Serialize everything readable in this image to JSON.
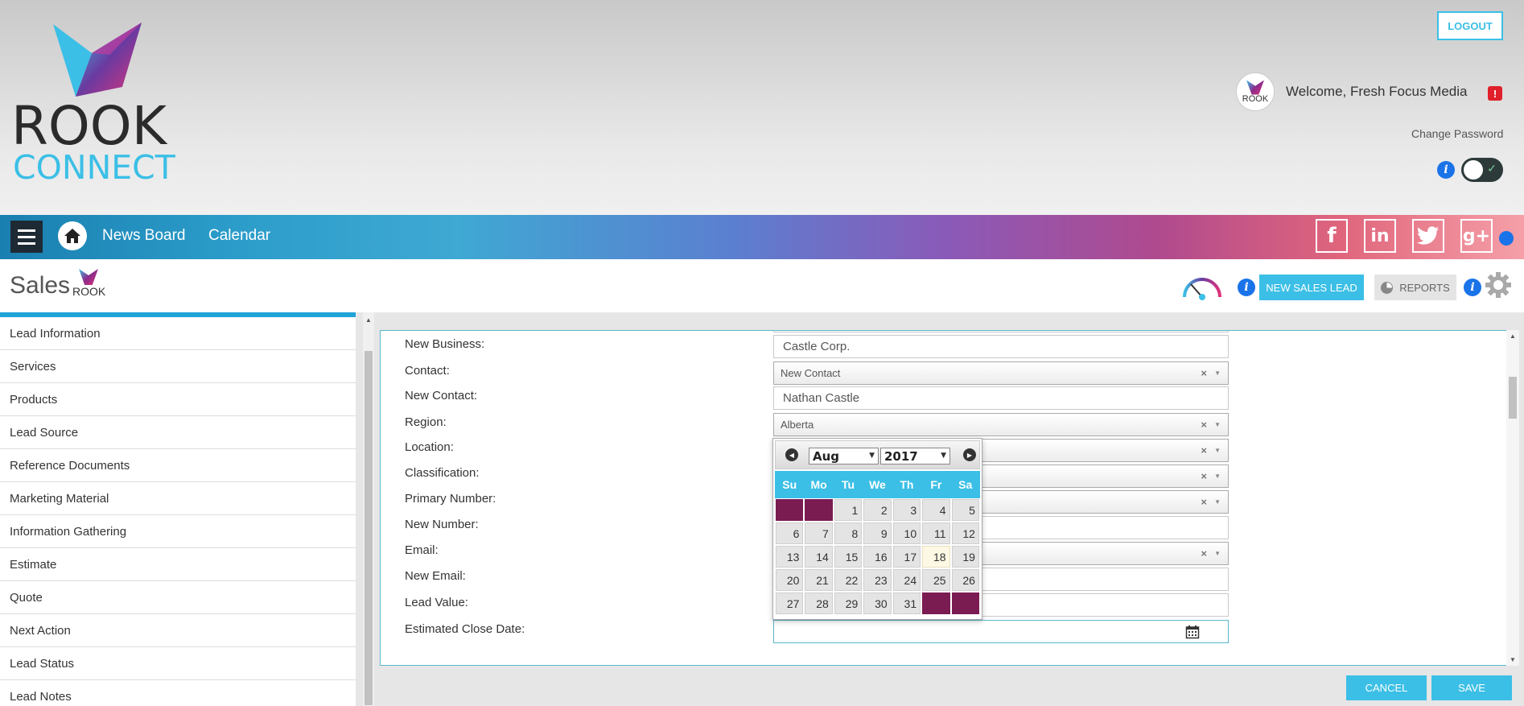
{
  "brand": {
    "logo_word1": "ROOK",
    "logo_word2": "CONNECT",
    "small_logo_text": "ROOK"
  },
  "header": {
    "logout_label": "LOGOUT",
    "welcome": "Welcome, Fresh Focus Media",
    "alert_symbol": "!",
    "change_password": "Change Password",
    "info_symbol": "i",
    "toggle_check": "✓"
  },
  "nav": {
    "links": [
      "News Board",
      "Calendar"
    ],
    "social": [
      {
        "name": "facebook-icon",
        "glyph": "f"
      },
      {
        "name": "linkedin-icon",
        "glyph": "in"
      },
      {
        "name": "twitter-icon",
        "glyph": "🐦"
      },
      {
        "name": "google-plus-icon",
        "glyph": "g+"
      }
    ]
  },
  "salesbar": {
    "title": "Sales",
    "new_lead": "NEW SALES LEAD",
    "reports": "REPORTS",
    "info_symbol": "i"
  },
  "sidebar": {
    "items": [
      "Lead Information",
      "Services",
      "Products",
      "Lead Source",
      "Reference Documents",
      "Marketing Material",
      "Information Gathering",
      "Estimate",
      "Quote",
      "Next Action",
      "Lead Status",
      "Lead Notes"
    ]
  },
  "form": {
    "new_business": {
      "label": "New Business:",
      "value": "Castle Corp."
    },
    "contact": {
      "label": "Contact:",
      "value": "New Contact"
    },
    "new_contact": {
      "label": "New Contact:",
      "value": "Nathan Castle"
    },
    "region": {
      "label": "Region:",
      "value": "Alberta"
    },
    "location": {
      "label": "Location:",
      "value": ""
    },
    "classification": {
      "label": "Classification:",
      "value": ""
    },
    "primary_number": {
      "label": "Primary Number:",
      "value": ""
    },
    "new_number": {
      "label": "New Number:",
      "value": ""
    },
    "email": {
      "label": "Email:",
      "value": ""
    },
    "new_email": {
      "label": "New Email:",
      "value": ""
    },
    "lead_value": {
      "label": "Lead Value:",
      "value": ""
    },
    "estimated_close_date": {
      "label": "Estimated Close Date:",
      "value": ""
    },
    "clear_symbol": "×"
  },
  "datepicker": {
    "month": "Aug",
    "year": "2017",
    "weekdays": [
      "Su",
      "Mo",
      "Tu",
      "We",
      "Th",
      "Fr",
      "Sa"
    ],
    "weeks": [
      [
        "",
        "",
        "1",
        "2",
        "3",
        "4",
        "5"
      ],
      [
        "6",
        "7",
        "8",
        "9",
        "10",
        "11",
        "12"
      ],
      [
        "13",
        "14",
        "15",
        "16",
        "17",
        "18",
        "19"
      ],
      [
        "20",
        "21",
        "22",
        "23",
        "24",
        "25",
        "26"
      ],
      [
        "27",
        "28",
        "29",
        "30",
        "31",
        "",
        ""
      ]
    ],
    "today": "18"
  },
  "footer": {
    "cancel": "CANCEL",
    "save": "SAVE"
  },
  "colors": {
    "accent": "#3bbfe6",
    "dark_empty_cell": "#7a1b52",
    "info_blue": "#1a73e8"
  }
}
